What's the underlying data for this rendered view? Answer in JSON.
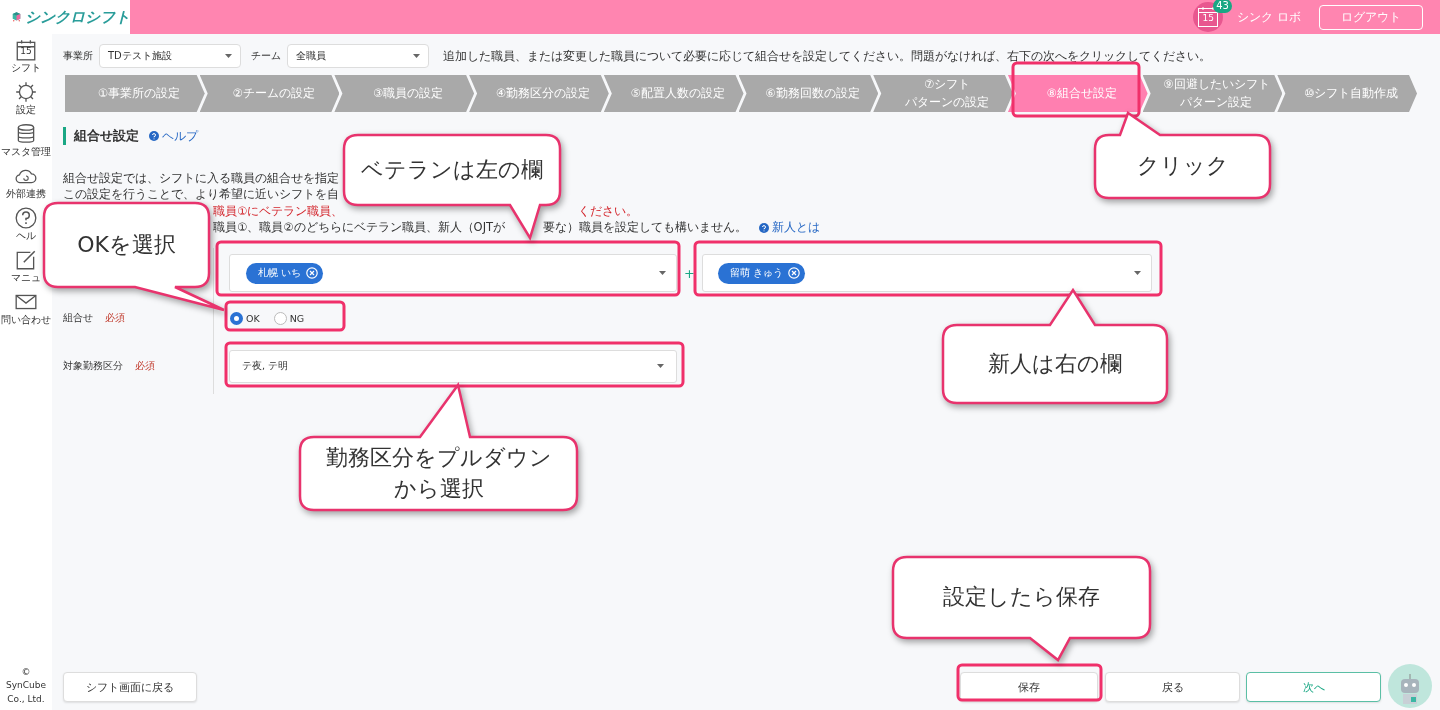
{
  "header": {
    "app_name": "シンクロシフト",
    "calendar_day": "15",
    "notification_count": "43",
    "user_name": "シンク ロボ",
    "logout": "ログアウト"
  },
  "sidebar": {
    "items": [
      {
        "kind": "calendar",
        "label": "シフト",
        "icon_text": "15"
      },
      {
        "kind": "gear",
        "label": "設定"
      },
      {
        "kind": "database",
        "label": "マスタ管理"
      },
      {
        "kind": "cloud",
        "label": "外部連携"
      },
      {
        "kind": "help",
        "label": "ヘル"
      },
      {
        "kind": "note",
        "label": "マニュ"
      },
      {
        "kind": "mail",
        "label": "問い合わせ"
      }
    ],
    "copyright": "© SynCube Co., Ltd."
  },
  "filters": [
    {
      "label": "事業所",
      "value": "TDテスト施設"
    },
    {
      "label": "チーム",
      "value": "全職員"
    }
  ],
  "instruction": "追加した職員、または変更した職員について必要に応じて組合せを設定してください。問題がなければ、右下の次へをクリックしてください。",
  "steps": [
    {
      "lines": [
        "①事業所の設定"
      ],
      "selected": false
    },
    {
      "lines": [
        "②チームの設定"
      ],
      "selected": false
    },
    {
      "lines": [
        "③職員の設定"
      ],
      "selected": false
    },
    {
      "lines": [
        "④勤務区分の設定"
      ],
      "selected": false
    },
    {
      "lines": [
        "⑤配置人数の設定"
      ],
      "selected": false
    },
    {
      "lines": [
        "⑥勤務回数の設定"
      ],
      "selected": false
    },
    {
      "lines": [
        "⑦シフト",
        "パターンの設定"
      ],
      "selected": false
    },
    {
      "lines": [
        "⑧組合せ設定"
      ],
      "selected": true
    },
    {
      "lines": [
        "⑨回避したいシフト",
        "パターン設定"
      ],
      "selected": false
    },
    {
      "lines": [
        "⑩シフト自動作成"
      ],
      "selected": false
    }
  ],
  "section": {
    "title": "組合せ設定",
    "help": "ヘルプ"
  },
  "description": [
    {
      "kind": "plain",
      "segments": [
        "組合せ設定では、シフトに入る職員の組合せを指定"
      ]
    },
    {
      "kind": "plain",
      "segments": [
        "この設定を行うことで、より希望に近いシフトを自"
      ]
    },
    {
      "kind": "warning",
      "segments": [
        "職員①にベテラン職員、",
        "ください。"
      ]
    },
    {
      "kind": "plain",
      "segments": [
        "職員①、職員②のどちらにベテラン職員、新人（OJTが",
        "要な）職員を設定しても構いません。"
      ],
      "link": "新人とは"
    }
  ],
  "form": {
    "staff_left": {
      "chips": [
        "札幌 いち"
      ]
    },
    "plus": "+",
    "staff_right": {
      "chips": [
        "留萌 きゅう"
      ]
    },
    "combination": {
      "label": "組合せ",
      "required": "必須",
      "options": [
        {
          "label": "OK",
          "selected": true
        },
        {
          "label": "NG",
          "selected": false
        }
      ]
    },
    "shift_type": {
      "label": "対象勤務区分",
      "required": "必須",
      "value": "テ夜, テ明"
    }
  },
  "footer": {
    "back_to_shift": "シフト画面に戻る",
    "save": "保存",
    "back": "戻る",
    "next": "次へ"
  },
  "annotations": [
    {
      "lines": [
        "ベテランは左の欄"
      ]
    },
    {
      "lines": [
        "OKを選択"
      ]
    },
    {
      "lines": [
        "クリック"
      ]
    },
    {
      "lines": [
        "新人は右の欄"
      ]
    },
    {
      "lines": [
        "勤務区分をプルダウン",
        "から選択"
      ]
    },
    {
      "lines": [
        "設定したら保存"
      ]
    }
  ]
}
